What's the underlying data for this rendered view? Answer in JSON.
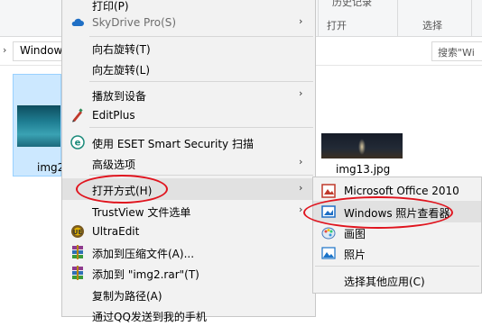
{
  "explorer": {
    "ribbon": {
      "history_label": "历史记录",
      "open_group": "打开",
      "select_group": "选择"
    },
    "address": {
      "path": "Window"
    },
    "search": {
      "placeholder": "搜索\"Wi"
    },
    "files": [
      {
        "name": "img2",
        "selected": true
      },
      {
        "name": "img13.jpg",
        "selected": false
      }
    ]
  },
  "context_menu": {
    "items": [
      {
        "label": "打印(P)",
        "icon": "none"
      },
      {
        "label": "SkyDrive Pro(S)",
        "icon": "cloud-icon",
        "submenu": true,
        "disabled": true
      },
      {
        "label": "向右旋转(T)"
      },
      {
        "label": "向左旋转(L)"
      },
      {
        "label": "播放到设备",
        "submenu": true
      },
      {
        "label": "EditPlus",
        "icon": "editplus-icon"
      },
      {
        "label": "使用 ESET Smart Security 扫描",
        "icon": "eset-icon"
      },
      {
        "label": "高级选项",
        "submenu": true
      },
      {
        "label": "打开方式(H)",
        "submenu": true,
        "highlighted": true
      },
      {
        "label": "TrustView 文件选单",
        "submenu": true
      },
      {
        "label": "UltraEdit",
        "icon": "ultraedit-icon"
      },
      {
        "label": "添加到压缩文件(A)...",
        "icon": "winrar-icon"
      },
      {
        "label": "添加到 \"img2.rar\"(T)",
        "icon": "winrar-icon"
      },
      {
        "label": "复制为路径(A)"
      },
      {
        "label": "通过QQ发送到我的手机"
      }
    ]
  },
  "open_with_submenu": {
    "items": [
      {
        "label": "Microsoft Office 2010",
        "icon": "office-picture-icon"
      },
      {
        "label": "Windows 照片查看器",
        "icon": "photo-viewer-icon",
        "highlighted": true
      },
      {
        "label": "画图",
        "icon": "paint-icon"
      },
      {
        "label": "照片",
        "icon": "photos-icon"
      },
      {
        "label": "选择其他应用(C)"
      }
    ]
  },
  "colors": {
    "annotation": "#e0141e",
    "menu_bg": "#f2f2f2",
    "highlight": "#e1e1e1",
    "selection": "#cce8ff"
  }
}
